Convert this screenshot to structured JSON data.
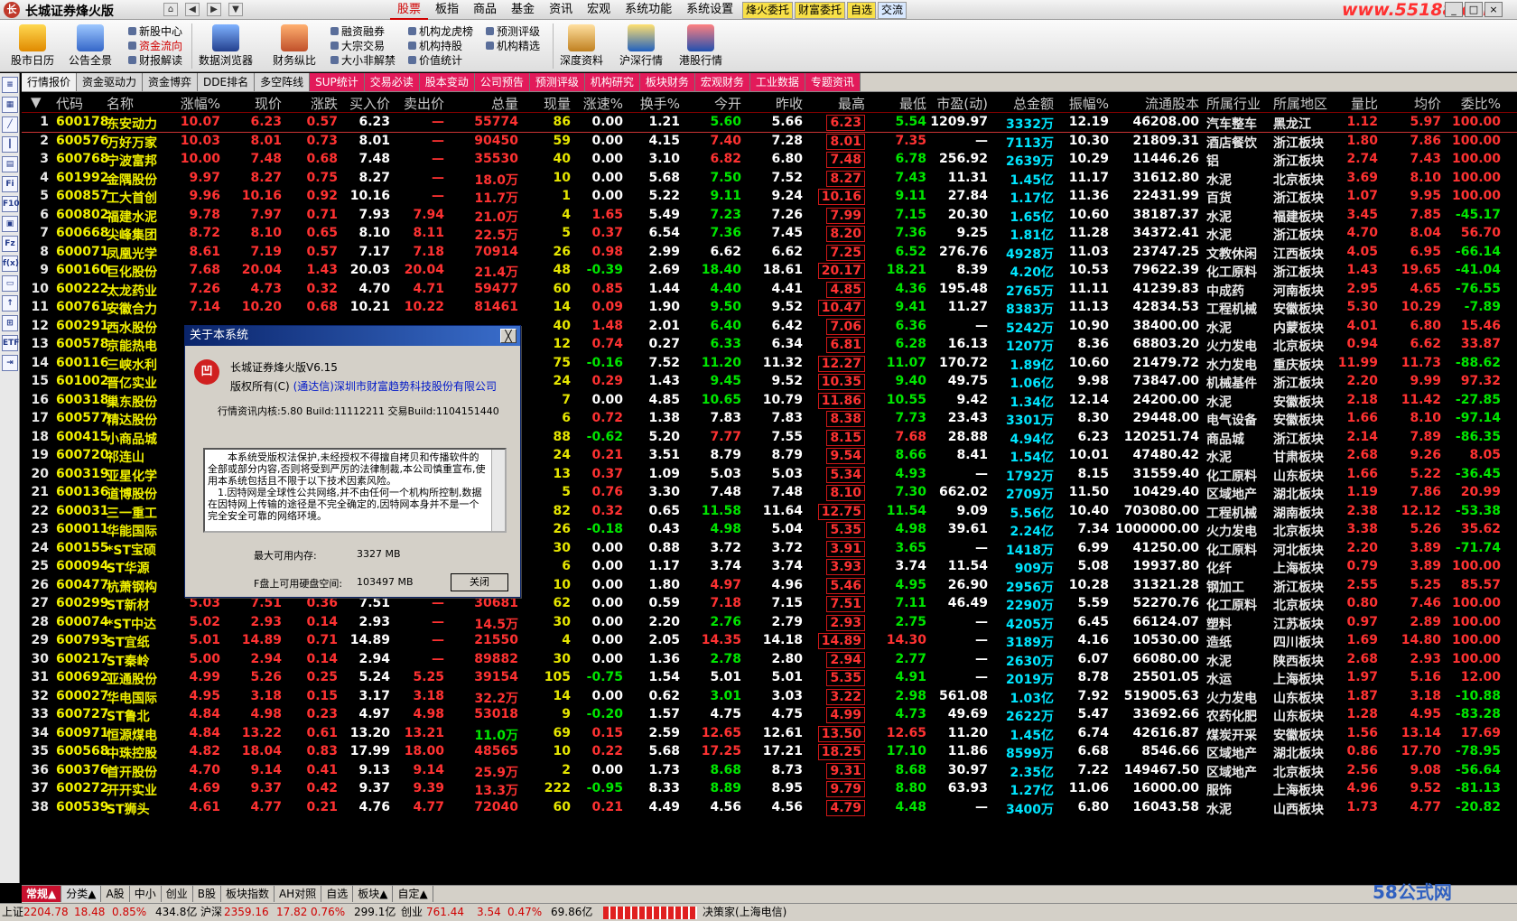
{
  "app": {
    "title": "长城证券烽火版",
    "logo": "长"
  },
  "menu": [
    "股票",
    "板指",
    "商品",
    "基金",
    "资讯",
    "宏观",
    "系统功能",
    "系统设置"
  ],
  "menu_active": "股票",
  "badges": [
    "烽火委托",
    "财富委托",
    "自选",
    "交流"
  ],
  "watermark": "www.55188.com",
  "toolbar": {
    "big1": [
      "股市日历",
      "公告全景"
    ],
    "group1": [
      "新股中心",
      "资金流向",
      "财报解读"
    ],
    "big2": [
      "数据浏览器",
      "财务纵比"
    ],
    "group2": [
      "融资融券",
      "大宗交易",
      "大小非解禁"
    ],
    "group3": [
      "机构龙虎榜",
      "机构持股",
      "价值统计"
    ],
    "group4": [
      "预测评级",
      "机构精选"
    ],
    "big3": [
      "深度资料",
      "沪深行情",
      "港股行情"
    ]
  },
  "sidebar_icons": [
    "list-icon",
    "grid-icon",
    "chart-icon",
    "candle-icon",
    "table-icon",
    "fin-icon",
    "f10-icon",
    "news-icon",
    "fz-icon",
    "formula-icon",
    "folder-icon",
    "arrow-icon",
    "calc-icon",
    "etf-icon",
    "exit-icon"
  ],
  "tabs": [
    "行情报价",
    "资金驱动力",
    "资金博弈",
    "DDE排名",
    "多空阵线",
    "SUP统计",
    "交易必读",
    "股本变动",
    "公司预告",
    "预测评级",
    "机构研究",
    "板块财务",
    "宏观财务",
    "工业数据",
    "专题资讯"
  ],
  "columns": [
    "代码",
    "名称",
    "涨幅%",
    "现价",
    "涨跌",
    "买入价",
    "卖出价",
    "总量",
    "现量",
    "涨速%",
    "换手%",
    "今开",
    "昨收",
    "最高",
    "最低",
    "市盈(动)",
    "总金额",
    "振幅%",
    "流通股本",
    "所属行业",
    "所属地区",
    "量比",
    "均价",
    "委比%"
  ],
  "rows": [
    [
      "1",
      "600178",
      "东安动力",
      "10.07",
      "6.23",
      "0.57",
      "6.23",
      "—",
      "55774",
      "86",
      "0.00",
      "1.21",
      "5.60",
      "5.66",
      "6.23",
      "5.54",
      "1209.97",
      "3332万",
      "12.19",
      "46208.00",
      "汽车整车",
      "黑龙江",
      "1.12",
      "5.97",
      "100.00"
    ],
    [
      "2",
      "600576",
      "万好万家",
      "10.03",
      "8.01",
      "0.73",
      "8.01",
      "—",
      "90450",
      "59",
      "0.00",
      "4.15",
      "7.40",
      "7.28",
      "8.01",
      "7.35",
      "—",
      "7113万",
      "10.30",
      "21809.31",
      "酒店餐饮",
      "浙江板块",
      "1.80",
      "7.86",
      "100.00"
    ],
    [
      "3",
      "600768",
      "宁波富邦",
      "10.00",
      "7.48",
      "0.68",
      "7.48",
      "—",
      "35530",
      "40",
      "0.00",
      "3.10",
      "6.82",
      "6.80",
      "7.48",
      "6.78",
      "256.92",
      "2639万",
      "10.29",
      "11446.26",
      "铝",
      "浙江板块",
      "2.74",
      "7.43",
      "100.00"
    ],
    [
      "4",
      "601992",
      "金隅股份",
      "9.97",
      "8.27",
      "0.75",
      "8.27",
      "—",
      "18.0万",
      "10",
      "0.00",
      "5.68",
      "7.50",
      "7.52",
      "8.27",
      "7.43",
      "11.31",
      "1.45亿",
      "11.17",
      "31612.80",
      "水泥",
      "北京板块",
      "3.69",
      "8.10",
      "100.00"
    ],
    [
      "5",
      "600857",
      "工大首创",
      "9.96",
      "10.16",
      "0.92",
      "10.16",
      "—",
      "11.7万",
      "1",
      "0.00",
      "5.22",
      "9.11",
      "9.24",
      "10.16",
      "9.11",
      "27.84",
      "1.17亿",
      "11.36",
      "22431.99",
      "百货",
      "浙江板块",
      "1.07",
      "9.95",
      "100.00"
    ],
    [
      "6",
      "600802",
      "福建水泥",
      "9.78",
      "7.97",
      "0.71",
      "7.93",
      "7.94",
      "21.0万",
      "4",
      "1.65",
      "5.49",
      "7.23",
      "7.26",
      "7.99",
      "7.15",
      "20.30",
      "1.65亿",
      "10.60",
      "38187.37",
      "水泥",
      "福建板块",
      "3.45",
      "7.85",
      "-45.17"
    ],
    [
      "7",
      "600668",
      "尖峰集团",
      "8.72",
      "8.10",
      "0.65",
      "8.10",
      "8.11",
      "22.5万",
      "5",
      "0.37",
      "6.54",
      "7.36",
      "7.45",
      "8.20",
      "7.36",
      "9.25",
      "1.81亿",
      "11.28",
      "34372.41",
      "水泥",
      "浙江板块",
      "4.70",
      "8.04",
      "56.70"
    ],
    [
      "8",
      "600071",
      "凤凰光学",
      "8.61",
      "7.19",
      "0.57",
      "7.17",
      "7.18",
      "70914",
      "26",
      "0.98",
      "2.99",
      "6.62",
      "6.62",
      "7.25",
      "6.52",
      "276.76",
      "4928万",
      "11.03",
      "23747.25",
      "文教休闲",
      "江西板块",
      "4.05",
      "6.95",
      "-66.14"
    ],
    [
      "9",
      "600160",
      "巨化股份",
      "7.68",
      "20.04",
      "1.43",
      "20.03",
      "20.04",
      "21.4万",
      "48",
      "-0.39",
      "2.69",
      "18.40",
      "18.61",
      "20.17",
      "18.21",
      "8.39",
      "4.20亿",
      "10.53",
      "79622.39",
      "化工原料",
      "浙江板块",
      "1.43",
      "19.65",
      "-41.04"
    ],
    [
      "10",
      "600222",
      "太龙药业",
      "7.26",
      "4.73",
      "0.32",
      "4.70",
      "4.71",
      "59477",
      "60",
      "0.85",
      "1.44",
      "4.40",
      "4.41",
      "4.85",
      "4.36",
      "195.48",
      "2765万",
      "11.11",
      "41239.83",
      "中成药",
      "河南板块",
      "2.95",
      "4.65",
      "-76.55"
    ],
    [
      "11",
      "600761",
      "安徽合力",
      "7.14",
      "10.20",
      "0.68",
      "10.21",
      "10.22",
      "81461",
      "14",
      "0.09",
      "1.90",
      "9.50",
      "9.52",
      "10.47",
      "9.41",
      "11.27",
      "8383万",
      "11.13",
      "42834.53",
      "工程机械",
      "安徽板块",
      "5.30",
      "10.29",
      "-7.89"
    ],
    [
      "12",
      "600291",
      "西水股份",
      "",
      "",
      "",
      "",
      "",
      "",
      "40",
      "1.48",
      "2.01",
      "6.40",
      "6.42",
      "7.06",
      "6.36",
      "—",
      "5242万",
      "10.90",
      "38400.00",
      "水泥",
      "内蒙板块",
      "4.01",
      "6.80",
      "15.46"
    ],
    [
      "13",
      "600578",
      "京能热电",
      "",
      "",
      "",
      "",
      "",
      "",
      "12",
      "0.74",
      "0.27",
      "6.33",
      "6.34",
      "6.81",
      "6.28",
      "16.13",
      "1207万",
      "8.36",
      "68803.20",
      "火力发电",
      "北京板块",
      "0.94",
      "6.62",
      "33.87"
    ],
    [
      "14",
      "600116",
      "三峡水利",
      "",
      "",
      "",
      "",
      "",
      "",
      "75",
      "-0.16",
      "7.52",
      "11.20",
      "11.32",
      "12.27",
      "11.07",
      "170.72",
      "1.89亿",
      "10.60",
      "21479.72",
      "水力发电",
      "重庆板块",
      "11.99",
      "11.73",
      "-88.62"
    ],
    [
      "15",
      "601002",
      "晋亿实业",
      "",
      "",
      "",
      "",
      "",
      "",
      "24",
      "0.29",
      "1.43",
      "9.45",
      "9.52",
      "10.35",
      "9.40",
      "49.75",
      "1.06亿",
      "9.98",
      "73847.00",
      "机械基件",
      "浙江板块",
      "2.20",
      "9.99",
      "97.32"
    ],
    [
      "16",
      "600318",
      "巢东股份",
      "",
      "",
      "",
      "",
      "",
      "",
      "7",
      "0.00",
      "4.85",
      "10.65",
      "10.79",
      "11.86",
      "10.55",
      "9.42",
      "1.34亿",
      "12.14",
      "24200.00",
      "水泥",
      "安徽板块",
      "2.18",
      "11.42",
      "-27.85"
    ],
    [
      "17",
      "600577",
      "精达股份",
      "",
      "",
      "",
      "",
      "",
      "",
      "6",
      "0.72",
      "1.38",
      "7.83",
      "7.83",
      "8.38",
      "7.73",
      "23.43",
      "3301万",
      "8.30",
      "29448.00",
      "电气设备",
      "安徽板块",
      "1.66",
      "8.10",
      "-97.14"
    ],
    [
      "18",
      "600415",
      "小商品城",
      "",
      "",
      "",
      "",
      "",
      "",
      "88",
      "-0.62",
      "5.20",
      "7.77",
      "7.55",
      "8.15",
      "7.68",
      "28.88",
      "4.94亿",
      "6.23",
      "120251.74",
      "商品城",
      "浙江板块",
      "2.14",
      "7.89",
      "-86.35"
    ],
    [
      "19",
      "600720",
      "祁连山",
      "",
      "",
      "",
      "",
      "",
      "",
      "24",
      "0.21",
      "3.51",
      "8.79",
      "8.79",
      "9.54",
      "8.66",
      "8.41",
      "1.54亿",
      "10.01",
      "47480.42",
      "水泥",
      "甘肃板块",
      "2.68",
      "9.26",
      "8.05"
    ],
    [
      "20",
      "600319",
      "亚星化学",
      "",
      "",
      "",
      "",
      "",
      "",
      "13",
      "0.37",
      "1.09",
      "5.03",
      "5.03",
      "5.34",
      "4.93",
      "—",
      "1792万",
      "8.15",
      "31559.40",
      "化工原料",
      "山东板块",
      "1.66",
      "5.22",
      "-36.45"
    ],
    [
      "21",
      "600136",
      "道博股份",
      "",
      "",
      "",
      "",
      "",
      "",
      "5",
      "0.76",
      "3.30",
      "7.48",
      "7.48",
      "8.10",
      "7.30",
      "662.02",
      "2709万",
      "11.50",
      "10429.40",
      "区域地产",
      "湖北板块",
      "1.19",
      "7.86",
      "20.99"
    ],
    [
      "22",
      "600031",
      "三一重工",
      "",
      "",
      "",
      "",
      "",
      "",
      "82",
      "0.32",
      "0.65",
      "11.58",
      "11.64",
      "12.75",
      "11.54",
      "9.09",
      "5.56亿",
      "10.40",
      "703080.00",
      "工程机械",
      "湖南板块",
      "2.38",
      "12.12",
      "-53.38"
    ],
    [
      "23",
      "600011",
      "华能国际",
      "",
      "",
      "",
      "",
      "",
      "",
      "26",
      "-0.18",
      "0.43",
      "4.98",
      "5.04",
      "5.35",
      "4.98",
      "39.61",
      "2.24亿",
      "7.34",
      "1000000.00",
      "火力发电",
      "北京板块",
      "3.38",
      "5.26",
      "35.62"
    ],
    [
      "24",
      "600155",
      "*ST宝硕",
      "",
      "",
      "",
      "",
      "",
      "",
      "30",
      "0.00",
      "0.88",
      "3.72",
      "3.72",
      "3.91",
      "3.65",
      "—",
      "1418万",
      "6.99",
      "41250.00",
      "化工原料",
      "河北板块",
      "2.20",
      "3.89",
      "-71.74"
    ],
    [
      "25",
      "600094",
      "ST华源",
      "",
      "",
      "",
      "",
      "",
      "",
      "6",
      "0.00",
      "1.17",
      "3.74",
      "3.74",
      "3.93",
      "3.74",
      "11.54",
      "909万",
      "5.08",
      "19937.80",
      "化纤",
      "上海板块",
      "0.79",
      "3.89",
      "100.00"
    ],
    [
      "26",
      "600477",
      "杭萧钢构",
      "5.04",
      "5.21",
      "0.25",
      "5.20",
      "5.21",
      "56261",
      "10",
      "0.00",
      "1.80",
      "4.97",
      "4.96",
      "5.46",
      "4.95",
      "26.90",
      "2956万",
      "10.28",
      "31321.28",
      "钢加工",
      "浙江板块",
      "2.55",
      "5.25",
      "85.57"
    ],
    [
      "27",
      "600299",
      "ST新材",
      "5.03",
      "7.51",
      "0.36",
      "7.51",
      "—",
      "30681",
      "62",
      "0.00",
      "0.59",
      "7.18",
      "7.15",
      "7.51",
      "7.11",
      "46.49",
      "2290万",
      "5.59",
      "52270.76",
      "化工原料",
      "北京板块",
      "0.80",
      "7.46",
      "100.00"
    ],
    [
      "28",
      "600074",
      "*ST中达",
      "5.02",
      "2.93",
      "0.14",
      "2.93",
      "—",
      "14.5万",
      "30",
      "0.00",
      "2.20",
      "2.76",
      "2.79",
      "2.93",
      "2.75",
      "—",
      "4205万",
      "6.45",
      "66124.07",
      "塑料",
      "江苏板块",
      "0.97",
      "2.89",
      "100.00"
    ],
    [
      "29",
      "600793",
      "ST宜纸",
      "5.01",
      "14.89",
      "0.71",
      "14.89",
      "—",
      "21550",
      "4",
      "0.00",
      "2.05",
      "14.35",
      "14.18",
      "14.89",
      "14.30",
      "—",
      "3189万",
      "4.16",
      "10530.00",
      "造纸",
      "四川板块",
      "1.69",
      "14.80",
      "100.00"
    ],
    [
      "30",
      "600217",
      "ST秦岭",
      "5.00",
      "2.94",
      "0.14",
      "2.94",
      "—",
      "89882",
      "30",
      "0.00",
      "1.36",
      "2.78",
      "2.80",
      "2.94",
      "2.77",
      "—",
      "2630万",
      "6.07",
      "66080.00",
      "水泥",
      "陕西板块",
      "2.68",
      "2.93",
      "100.00"
    ],
    [
      "31",
      "600692",
      "亚通股份",
      "4.99",
      "5.26",
      "0.25",
      "5.24",
      "5.25",
      "39154",
      "105",
      "-0.75",
      "1.54",
      "5.01",
      "5.01",
      "5.35",
      "4.91",
      "—",
      "2019万",
      "8.78",
      "25501.05",
      "水运",
      "上海板块",
      "1.97",
      "5.16",
      "12.00"
    ],
    [
      "32",
      "600027",
      "华电国际",
      "4.95",
      "3.18",
      "0.15",
      "3.17",
      "3.18",
      "32.2万",
      "14",
      "0.00",
      "0.62",
      "3.01",
      "3.03",
      "3.22",
      "2.98",
      "561.08",
      "1.03亿",
      "7.92",
      "519005.63",
      "火力发电",
      "山东板块",
      "1.87",
      "3.18",
      "-10.88"
    ],
    [
      "33",
      "600727",
      "ST鲁北",
      "4.84",
      "4.98",
      "0.23",
      "4.97",
      "4.98",
      "53018",
      "9",
      "-0.20",
      "1.57",
      "4.75",
      "4.75",
      "4.99",
      "4.73",
      "49.69",
      "2622万",
      "5.47",
      "33692.66",
      "农药化肥",
      "山东板块",
      "1.28",
      "4.95",
      "-83.28"
    ],
    [
      "34",
      "600971",
      "恒源煤电",
      "4.84",
      "13.22",
      "0.61",
      "13.20",
      "13.21",
      "11.0万",
      "69",
      "0.15",
      "2.59",
      "12.65",
      "12.61",
      "13.50",
      "12.65",
      "11.20",
      "1.45亿",
      "6.74",
      "42616.87",
      "煤炭开采",
      "安徽板块",
      "1.56",
      "13.14",
      "17.69"
    ],
    [
      "35",
      "600568",
      "中珠控股",
      "4.82",
      "18.04",
      "0.83",
      "17.99",
      "18.00",
      "48565",
      "10",
      "0.22",
      "5.68",
      "17.25",
      "17.21",
      "18.25",
      "17.10",
      "11.86",
      "8599万",
      "6.68",
      "8546.66",
      "区域地产",
      "湖北板块",
      "0.86",
      "17.70",
      "-78.95"
    ],
    [
      "36",
      "600376",
      "首开股份",
      "4.70",
      "9.14",
      "0.41",
      "9.13",
      "9.14",
      "25.9万",
      "2",
      "0.00",
      "1.73",
      "8.68",
      "8.73",
      "9.31",
      "8.68",
      "30.97",
      "2.35亿",
      "7.22",
      "149467.50",
      "区域地产",
      "北京板块",
      "2.56",
      "9.08",
      "-56.64"
    ],
    [
      "37",
      "600272",
      "开开实业",
      "4.69",
      "9.37",
      "0.42",
      "9.37",
      "9.39",
      "13.3万",
      "222",
      "-0.95",
      "8.33",
      "8.89",
      "8.95",
      "9.79",
      "8.80",
      "63.93",
      "1.27亿",
      "11.06",
      "16000.00",
      "服饰",
      "上海板块",
      "4.96",
      "9.52",
      "-81.13"
    ],
    [
      "38",
      "600539",
      "ST狮头",
      "4.61",
      "4.77",
      "0.21",
      "4.76",
      "4.77",
      "72040",
      "60",
      "0.21",
      "4.49",
      "4.56",
      "4.56",
      "4.79",
      "4.48",
      "—",
      "3400万",
      "6.80",
      "16043.58",
      "水泥",
      "山西板块",
      "1.73",
      "4.77",
      "-20.82"
    ]
  ],
  "dialog": {
    "title": "关于本系统",
    "close": "╳",
    "product": "长城证券烽火版V6.15",
    "copyright_prefix": "版权所有(C)",
    "company": "(通达信)深圳市财富趋势科技股份有限公司",
    "build": "行情资讯内核:5.80 Build:11112211 交易Build:1104151440",
    "notice1": "本系统受版权法保护,未经授权不得擅自拷贝和传播软件的全部或部分内容,否则将受到严厉的法律制裁,本公司慎重宣布,使用本系统包括且不限于以下技术因素风险。",
    "notice2": "1.因特网是全球性公共网络,并不由任何一个机构所控制,数据在因特网上传输的途径是不完全确定的,因特网本身并不是一个完全安全可靠的网络环境。",
    "memory_label": "最大可用内存:",
    "memory_value": "3327 MB",
    "disk_label": "F盘上可用硬盘空间:",
    "disk_value": "103497 MB",
    "ok": "关闭"
  },
  "sheets": [
    "常规▲",
    "分类▲",
    "A股",
    "中小",
    "创业",
    "B股",
    "板块指数",
    "AH对照",
    "自选",
    "板块▲",
    "自定▲"
  ],
  "status": {
    "sh_label": "上证",
    "sh_value": "2204.78",
    "sh_chg": "18.48",
    "sh_pct": "0.85%",
    "sh_amt": "434.8亿",
    "hs_label": "沪深",
    "hs_value": "2359.16",
    "hs_chg": "17.82",
    "hs_pct": "0.76%",
    "hs_amt": "299.1亿",
    "cy_label": "创业",
    "cy_value": "761.44",
    "cy_chg": "3.54",
    "cy_pct": "0.47%",
    "cy_amt": "69.86亿",
    "server": "决策家(上海电信)",
    "brand": "58公式网"
  }
}
